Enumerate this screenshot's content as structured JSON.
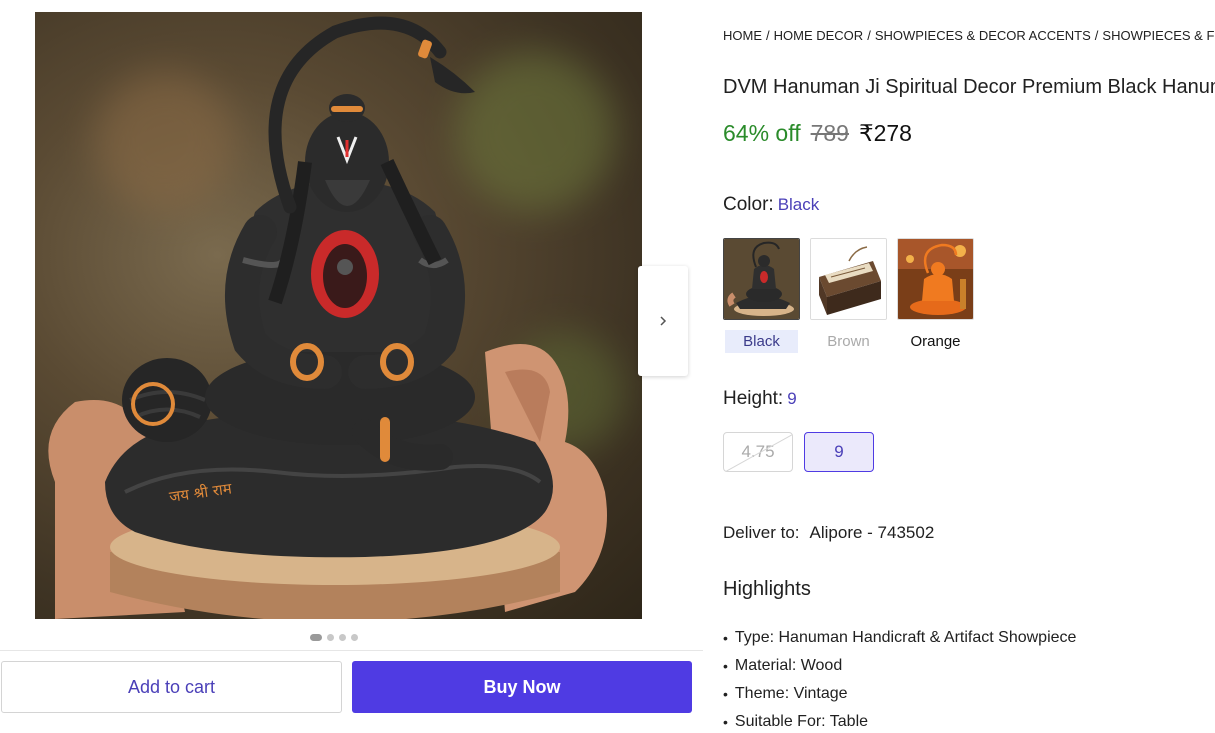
{
  "breadcrumb": [
    "HOME",
    "HOME DECOR",
    "SHOWPIECES & DECOR ACCENTS",
    "SHOWPIECES & FIGURINES"
  ],
  "product": {
    "title": "DVM Hanuman Ji Spiritual Decor Premium Black Hanuman Idol",
    "discount": "64% off",
    "mrp": "789",
    "price": "₹278"
  },
  "image": {
    "inscription": "जय श्री राम",
    "pagination_dots": 4,
    "active_dot": 1,
    "next_icon": "chevron-right-icon"
  },
  "color": {
    "label": "Color:",
    "selected": "Black",
    "options": [
      {
        "name": "Black",
        "state": "selected"
      },
      {
        "name": "Brown",
        "state": "disabled"
      },
      {
        "name": "Orange",
        "state": "available"
      }
    ]
  },
  "height": {
    "label": "Height:",
    "selected": "9",
    "options": [
      {
        "value": "4.75",
        "state": "disabled"
      },
      {
        "value": "9",
        "state": "selected"
      }
    ]
  },
  "delivery": {
    "label": "Deliver to:",
    "location": "Alipore - 743502"
  },
  "highlights": {
    "title": "Highlights",
    "items": [
      "Type: Hanuman Handicraft & Artifact Showpiece",
      "Material: Wood",
      "Theme: Vintage",
      "Suitable For: Table"
    ]
  },
  "actions": {
    "add_to_cart": "Add to cart",
    "buy_now": "Buy Now"
  },
  "colors": {
    "accent": "#4f3be3",
    "discount_green": "#2a8b2a",
    "link_purple": "#4a3fb8"
  }
}
